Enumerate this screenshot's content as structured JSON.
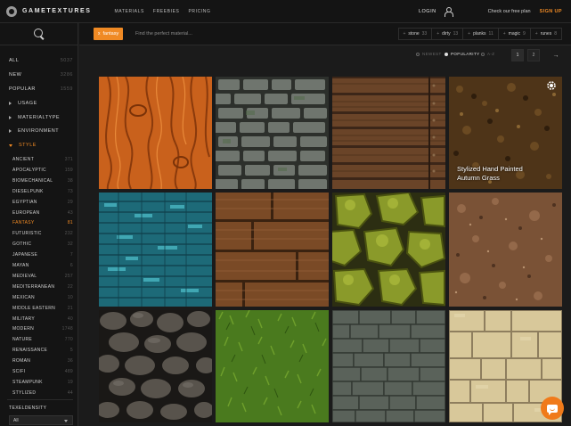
{
  "brand": {
    "name": "GAMETEXTURES"
  },
  "nav": {
    "items": [
      "MATERIALS",
      "FREEBIES",
      "PRICING"
    ]
  },
  "account": {
    "login": "LOGIN",
    "free_plan": "Check our free plan",
    "signup": "SIGN UP"
  },
  "sidebar": {
    "top": [
      {
        "label": "ALL",
        "count": "5037"
      },
      {
        "label": "NEW",
        "count": "3286"
      },
      {
        "label": "POPULAR",
        "count": "1559"
      }
    ],
    "groups": [
      "USAGE",
      "MATERIALTYPE",
      "ENVIRONMENT"
    ],
    "style_group": "STYLE",
    "styles": [
      {
        "label": "ANCIENT",
        "count": "371"
      },
      {
        "label": "APOCALYPTIC",
        "count": "159"
      },
      {
        "label": "BIOMECHANICAL",
        "count": "38"
      },
      {
        "label": "DIESELPUNK",
        "count": "73"
      },
      {
        "label": "EGYPTIAN",
        "count": "29"
      },
      {
        "label": "EUROPEAN",
        "count": "43"
      },
      {
        "label": "FANTASY",
        "count": "81",
        "active": true
      },
      {
        "label": "FUTURISTIC",
        "count": "232"
      },
      {
        "label": "GOTHIC",
        "count": "32"
      },
      {
        "label": "JAPANESE",
        "count": "7"
      },
      {
        "label": "MAYAN",
        "count": "6"
      },
      {
        "label": "MEDIEVAL",
        "count": "257"
      },
      {
        "label": "MEDITERRANEAN",
        "count": "22"
      },
      {
        "label": "MEXICAN",
        "count": "10"
      },
      {
        "label": "MIDDLE EASTERN",
        "count": "21"
      },
      {
        "label": "MILITARY",
        "count": "40"
      },
      {
        "label": "MODERN",
        "count": "1748"
      },
      {
        "label": "NATURE",
        "count": "770"
      },
      {
        "label": "RENAISSANCE",
        "count": "5"
      },
      {
        "label": "ROMAN",
        "count": "36"
      },
      {
        "label": "SCIFI",
        "count": "489"
      },
      {
        "label": "STEAMPUNK",
        "count": "19"
      },
      {
        "label": "STYLIZED",
        "count": "44"
      }
    ],
    "texel": {
      "label": "TEXELDENSITY",
      "value": "All"
    }
  },
  "search": {
    "chip": "fantasy",
    "chip_icon": "x",
    "placeholder": "Find the perfect material..."
  },
  "tags": [
    {
      "label": "stone",
      "count": "33"
    },
    {
      "label": "dirty",
      "count": "13"
    },
    {
      "label": "planks",
      "count": "11"
    },
    {
      "label": "magic",
      "count": "9"
    },
    {
      "label": "runes",
      "count": "8"
    }
  ],
  "sort": {
    "options": [
      "NEWEST",
      "POPULARITY",
      "A-Z"
    ],
    "selected": "POPULARITY"
  },
  "pagination": {
    "pages": [
      "1",
      "2"
    ],
    "current": "1",
    "next": "→"
  },
  "tiles": [
    {
      "name": "orange-wood"
    },
    {
      "name": "stone-wall"
    },
    {
      "name": "wood-planks-dark"
    },
    {
      "name": "autumn-grass",
      "label_line1": "Stylized Hand Painted",
      "label_line2": "Autumn Grass",
      "badge_icon": "settings-icon"
    },
    {
      "name": "blue-crystal"
    },
    {
      "name": "wood-planks"
    },
    {
      "name": "green-rocks"
    },
    {
      "name": "dirt-ground"
    },
    {
      "name": "cobblestone"
    },
    {
      "name": "grass"
    },
    {
      "name": "grey-stone-bricks"
    },
    {
      "name": "sandstone-tiles"
    }
  ],
  "colors": {
    "accent": "#f08a24",
    "background": "#1b1b1b",
    "panel": "#141414"
  }
}
